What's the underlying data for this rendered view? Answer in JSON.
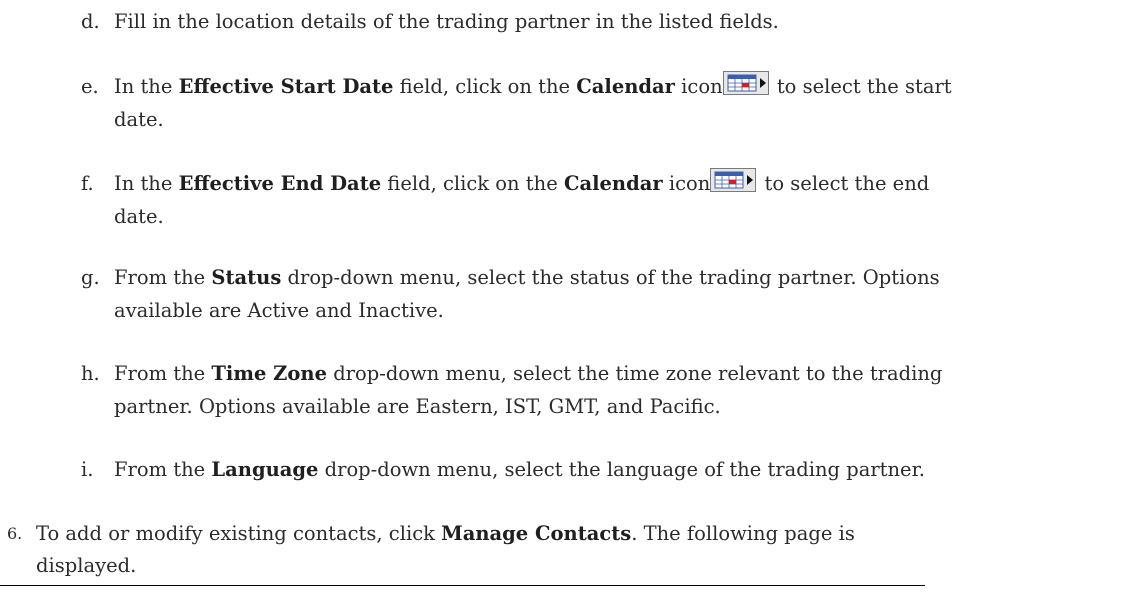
{
  "steps": [
    {
      "label": "d.",
      "pre": "Fill in the location details of the trading partner in the listed fields."
    },
    {
      "label": "e.",
      "pre": "In the ",
      "b1": "Effective Start Date",
      "mid": " field, click on the ",
      "b2": "Calendar",
      "icon_text": " icon",
      "post": " to select the start",
      "cont": "date."
    },
    {
      "label": "f.",
      "pre": "In the ",
      "b1": "Effective End Date",
      "mid": " field, click on the ",
      "b2": "Calendar",
      "icon_text": " icon",
      "post": " to select the end",
      "cont": "date."
    },
    {
      "label": "g.",
      "pre": "From the ",
      "b1": "Status",
      "post": " drop-down menu, select the status of the trading partner. Options",
      "cont": "available are Active and Inactive."
    },
    {
      "label": "h.",
      "pre": "From the ",
      "b1": "Time Zone",
      "post": " drop-down menu, select the time zone relevant to the trading",
      "cont": "partner. Options available are Eastern, IST, GMT, and Pacific."
    },
    {
      "label": "i.",
      "pre": "From the ",
      "b1": "Language",
      "post": " drop-down menu, select the language of the trading partner."
    }
  ],
  "numbered_step": {
    "label": "6.",
    "pre": "To add or modify existing contacts, click ",
    "b1": "Manage Contacts",
    "post": ". The following page is",
    "cont": "displayed."
  },
  "icons": {
    "calendar": "calendar-icon"
  }
}
